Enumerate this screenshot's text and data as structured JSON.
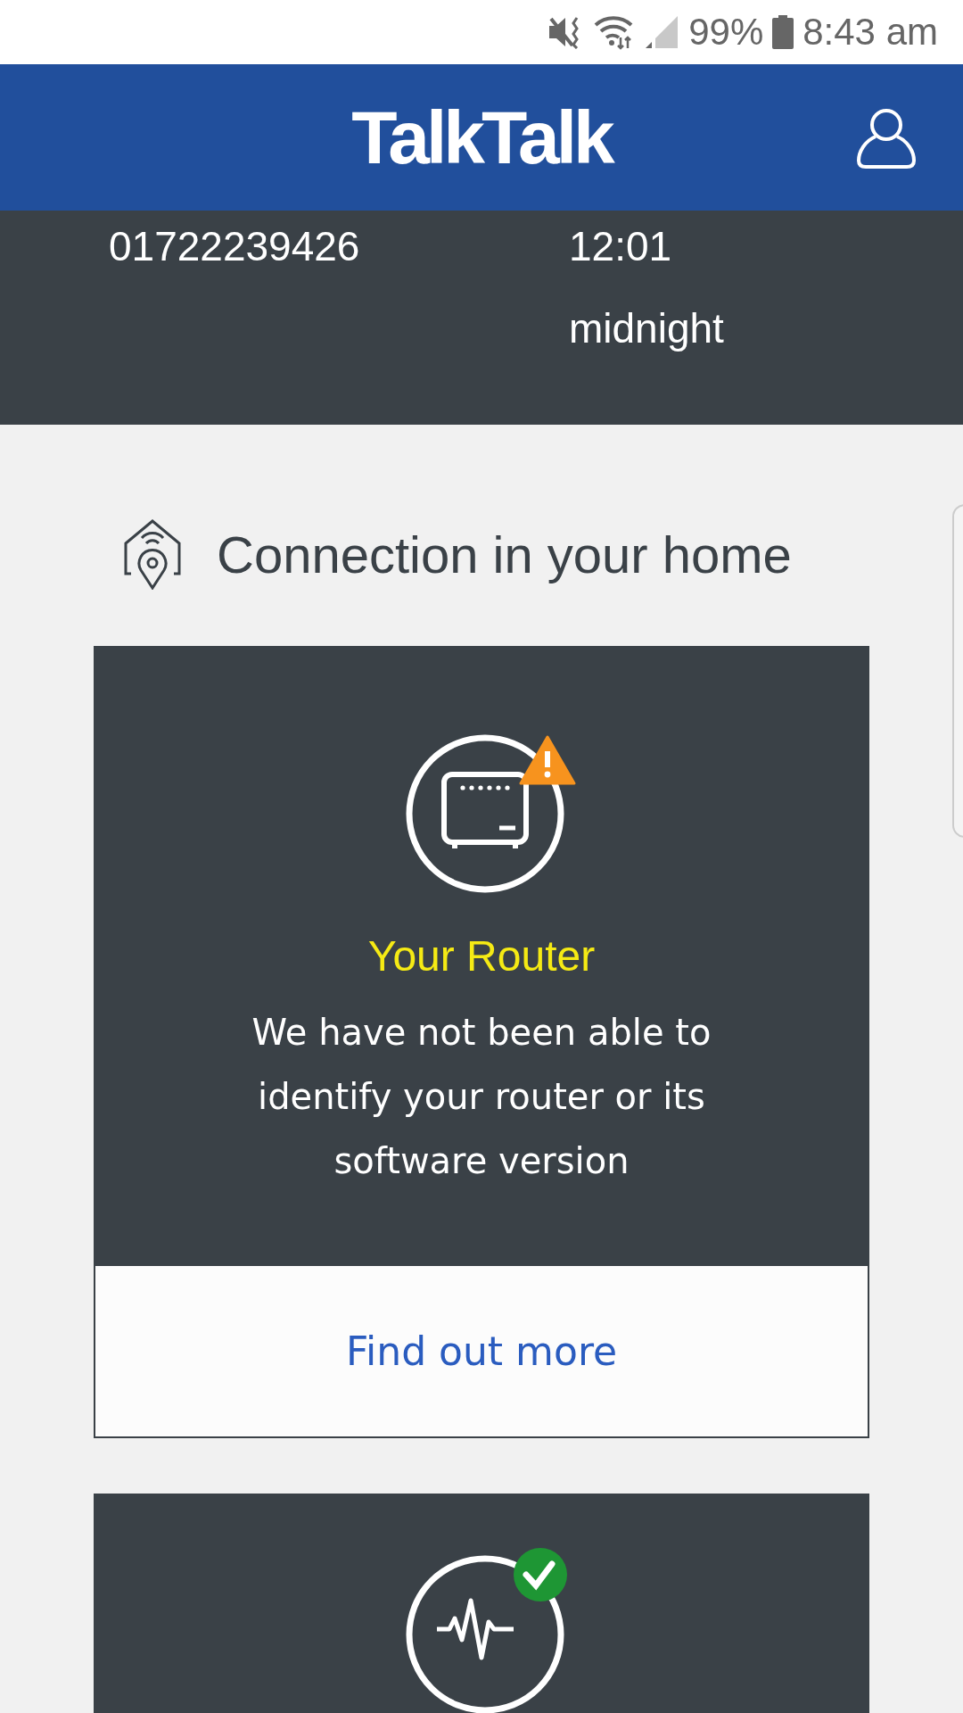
{
  "status_bar": {
    "battery": "99%",
    "time": "8:43 am"
  },
  "header": {
    "logo": "TalkTalk"
  },
  "line_info": {
    "number": "01722239426",
    "time": "12:01 midnight"
  },
  "section": {
    "title": "Connection in your home"
  },
  "cards": [
    {
      "kind": "router_warning",
      "title": "Your Router",
      "description": "We have not been able to identify your router or its software version",
      "link": "Find out more"
    },
    {
      "kind": "line_ok"
    }
  ]
}
